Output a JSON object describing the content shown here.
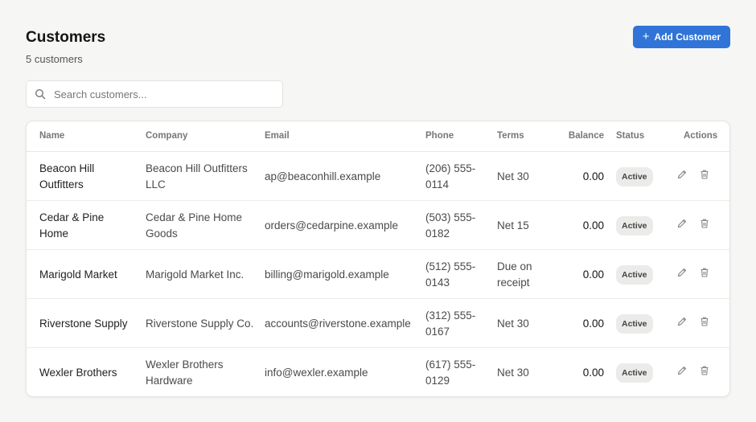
{
  "header": {
    "title": "Customers",
    "subtitle": "5 customers",
    "add_button": "Add Customer"
  },
  "search": {
    "placeholder": "Search customers...",
    "value": ""
  },
  "table": {
    "columns": [
      "Name",
      "Company",
      "Email",
      "Phone",
      "Terms",
      "Balance",
      "Status",
      "Actions"
    ],
    "rows": [
      {
        "name": "Beacon Hill Outfitters",
        "company": "Beacon Hill Outfitters LLC",
        "email": "ap@beaconhill.example",
        "phone": "(206) 555-0114",
        "terms": "Net 30",
        "balance": "0.00",
        "status": "Active"
      },
      {
        "name": "Cedar & Pine Home",
        "company": "Cedar & Pine Home Goods",
        "email": "orders@cedarpine.example",
        "phone": "(503) 555-0182",
        "terms": "Net 15",
        "balance": "0.00",
        "status": "Active"
      },
      {
        "name": "Marigold Market",
        "company": "Marigold Market Inc.",
        "email": "billing@marigold.example",
        "phone": "(512) 555-0143",
        "terms": "Due on receipt",
        "balance": "0.00",
        "status": "Active"
      },
      {
        "name": "Riverstone Supply",
        "company": "Riverstone Supply Co.",
        "email": "accounts@riverstone.example",
        "phone": "(312) 555-0167",
        "terms": "Net 30",
        "balance": "0.00",
        "status": "Active"
      },
      {
        "name": "Wexler Brothers",
        "company": "Wexler Brothers Hardware",
        "email": "info@wexler.example",
        "phone": "(617) 555-0129",
        "terms": "Net 30",
        "balance": "0.00",
        "status": "Active"
      }
    ]
  },
  "icons": {
    "search": "search-icon",
    "add": "plus-icon",
    "edit": "pencil-icon",
    "delete": "trash-icon"
  },
  "colors": {
    "accent": "#2f74d6",
    "background": "#f6f6f5",
    "badge_bg": "#ebebea"
  }
}
